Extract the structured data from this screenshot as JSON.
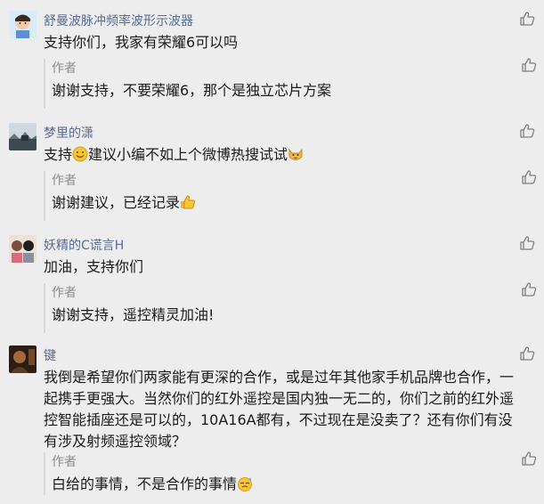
{
  "comments": [
    {
      "nickname": "舒曼波脉冲频率波形示波器",
      "content": "支持你们，我家有荣耀6可以吗",
      "reply_author": "作者",
      "reply_text": "谢谢支持，不要荣耀6，那个是独立芯片方案"
    },
    {
      "nickname": "梦里的潇",
      "content_before": "支持",
      "content_middle": "建议小编不如上个微博热搜试试",
      "reply_author": "作者",
      "reply_text": "谢谢建议，已经记录"
    },
    {
      "nickname": "妖精的C谎言H",
      "content": "加油，支持你们",
      "reply_author": "作者",
      "reply_text": "谢谢支持，遥控精灵加油!"
    },
    {
      "nickname": "键",
      "content_lines": [
        "我倒是希望你们两家能有更深的合作，或是过年其他家手机品牌也合作，一",
        "起携手更强大。当然你们的红外遥控是国内独一无二的，你们之前的红外遥",
        "控智能插座还是可以的，10A16A都有，不过现在是没卖了？还有你们有没",
        "有涉及射频遥控领域？"
      ],
      "reply_author": "作者",
      "reply_text": "白给的事情，不是合作的事情"
    }
  ],
  "icons": {
    "like": "thumbs-up-outline-icon",
    "smile": "smile-emoji-icon",
    "cat": "cat-emoji-icon",
    "thumbs": "thumbs-up-emoji-icon",
    "sweat": "sweat-emoji-icon"
  },
  "colors": {
    "nickname": "#576b95",
    "author": "#8c8c8c",
    "text": "#1a1a1a",
    "background": "#ededed"
  }
}
